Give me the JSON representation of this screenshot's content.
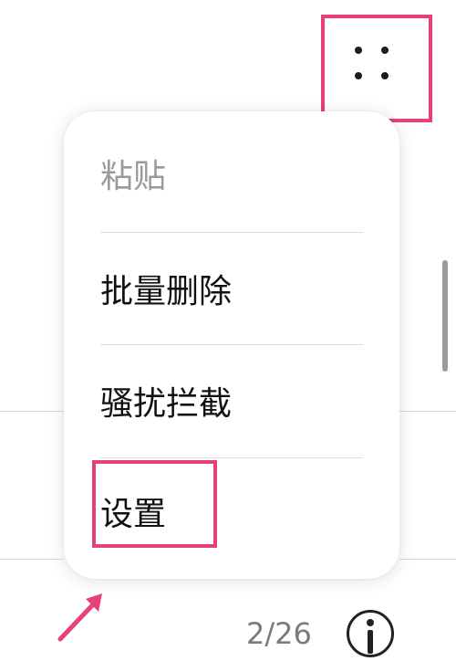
{
  "more_button": {
    "icon": "more-dots-icon"
  },
  "menu": {
    "items": [
      {
        "label": "粘贴",
        "enabled": false
      },
      {
        "label": "批量删除",
        "enabled": true
      },
      {
        "label": "骚扰拦截",
        "enabled": true
      },
      {
        "label": "设置",
        "enabled": true
      }
    ]
  },
  "footer": {
    "page_indicator": "2/26",
    "info_icon": "info-icon"
  },
  "annotation": {
    "color": "#e8417a",
    "arrow_icon": "pointer-arrow-icon"
  }
}
